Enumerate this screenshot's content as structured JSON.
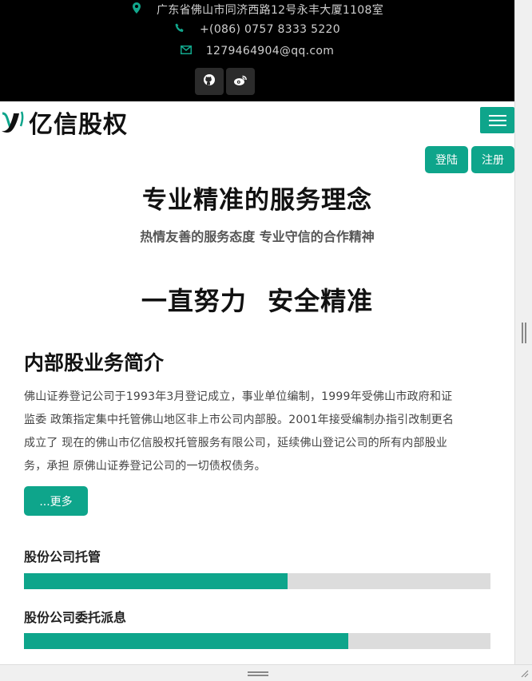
{
  "topbar": {
    "address": "广东省佛山市同济西路12号永丰大厦1108室",
    "phone": "+(086) 0757 8333 5220",
    "email": "1279464904@qq.com",
    "icons": [
      "map-marker-icon",
      "phone-icon",
      "envelope-icon",
      "github-icon",
      "weibo-icon"
    ]
  },
  "navbar": {
    "logo_text": "亿信股权"
  },
  "auth": {
    "login_label": "登陆",
    "register_label": "注册"
  },
  "hero": {
    "title": "专业精准的服务理念",
    "subtitle": "热情友善的服务态度 专业守信的合作精神",
    "slogan": "一直努力 安全精准"
  },
  "intro": {
    "title": "内部股业务简介",
    "lines": [
      "佛山证券登记公司于1993年3月登记成立，事业单位编制，1999年受佛山市政府和证",
      "监委 政策指定集中托管佛山地区非上市公司内部股。2001年接受编制办指引改制更名",
      "成立了 现在的佛山市亿信股权托管服务有限公司，延续佛山登记公司的所有内部股业",
      "务，承担 原佛山证券登记公司的一切债权债务。"
    ],
    "more_label": "...更多"
  },
  "skills": [
    {
      "label": "股份公司托管",
      "fraction": 0.565
    },
    {
      "label": "股份公司委托派息",
      "fraction": 0.695
    }
  ],
  "colors": {
    "accent": "#0ea58b",
    "topbar_bg": "#000000",
    "bar_track": "#dcdcdc"
  }
}
